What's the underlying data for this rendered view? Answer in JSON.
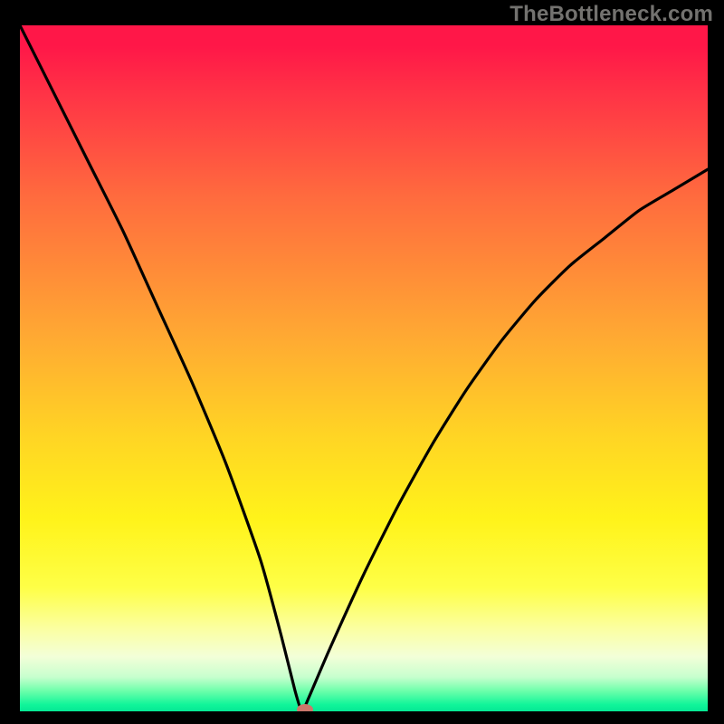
{
  "watermark": "TheBottleneck.com",
  "colors": {
    "background": "#000000",
    "curve": "#000000",
    "marker": "#cb776b",
    "gradient_top": "#ff1748",
    "gradient_bottom": "#05e894"
  },
  "chart_data": {
    "type": "line",
    "title": "",
    "xlabel": "",
    "ylabel": "",
    "xlim": [
      0,
      100
    ],
    "ylim": [
      0,
      100
    ],
    "x": [
      0,
      5,
      10,
      15,
      20,
      25,
      30,
      35,
      38,
      40,
      41,
      42,
      45,
      50,
      55,
      60,
      65,
      70,
      75,
      80,
      85,
      90,
      95,
      100
    ],
    "values": [
      100,
      90,
      80,
      70,
      59,
      48,
      36,
      22,
      11,
      3,
      0,
      2,
      9,
      20,
      30,
      39,
      47,
      54,
      60,
      65,
      69,
      73,
      76,
      79
    ],
    "marker": {
      "x": 41.5,
      "y": 0.3
    },
    "notes": "V-shaped bottleneck curve; minimum near x≈41; right branch asymptotes near ~80%."
  }
}
